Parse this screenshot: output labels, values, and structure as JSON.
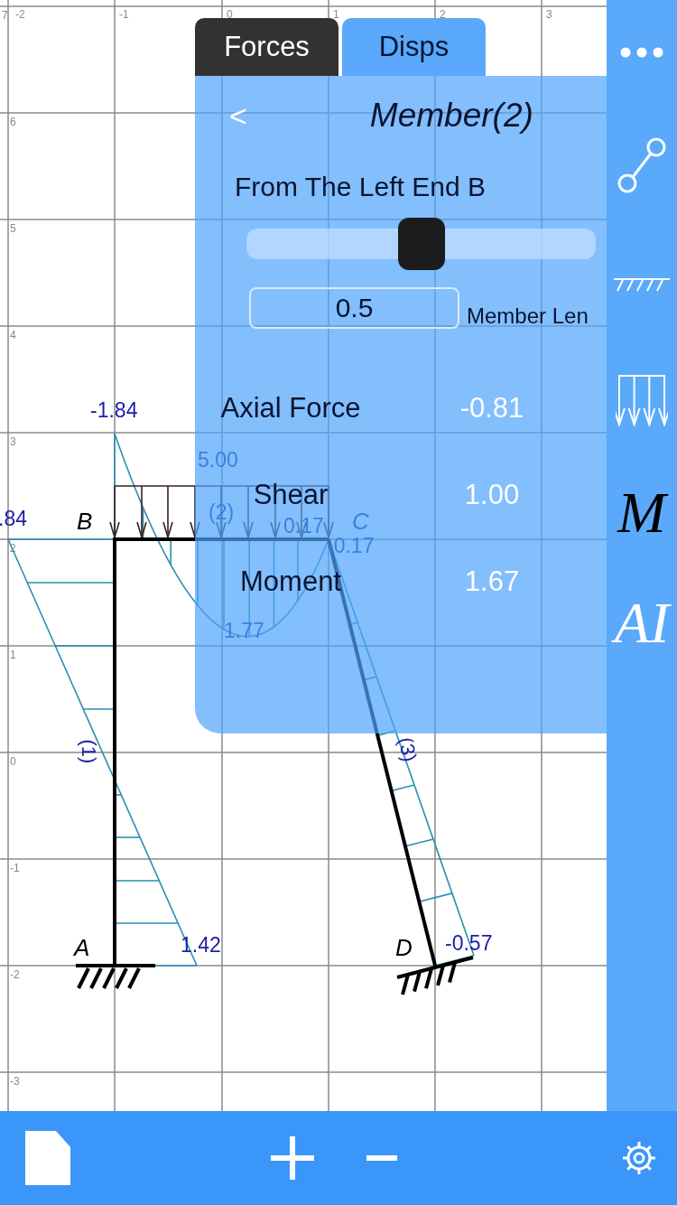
{
  "tabs": [
    {
      "label": "Forces",
      "selected": false
    },
    {
      "label": "Disps",
      "selected": true
    }
  ],
  "panel": {
    "back": "<",
    "title": "Member(2)",
    "position_label": "From The Left End B",
    "slider": {
      "level": 0.5
    },
    "position_field": {
      "value": "0.5"
    },
    "unit_label": "Member Len",
    "results": [
      {
        "label": "Axial Force",
        "value": "-0.81"
      },
      {
        "label": "Shear",
        "value": "1.00"
      },
      {
        "label": "Moment",
        "value": "1.67"
      }
    ]
  },
  "sidebar": {
    "items": [
      {
        "kind": "more"
      },
      {
        "kind": "member"
      },
      {
        "kind": "support"
      },
      {
        "kind": "load"
      },
      {
        "kind": "letter-dark",
        "text": "M"
      },
      {
        "kind": "letter-light",
        "text": "AI"
      }
    ]
  },
  "canvas": {
    "x_ticks": [
      "-2",
      "-1",
      "0",
      "1",
      "2",
      "3"
    ],
    "y_ticks": [
      "7",
      "6",
      "5",
      "4",
      "3",
      "2",
      "1",
      "0",
      "-1",
      "-2",
      "-3"
    ],
    "labels": [
      {
        "kind": "value",
        "text": "-1.84"
      },
      {
        "kind": "value",
        "text": ".84"
      },
      {
        "kind": "value",
        "text": "1.42"
      },
      {
        "kind": "value",
        "text": "-0.57"
      },
      {
        "kind": "faint",
        "text": "5.00"
      },
      {
        "kind": "faint",
        "text": "(2)"
      },
      {
        "kind": "faint",
        "text": "0.17"
      },
      {
        "kind": "faint",
        "text": "-0.17"
      },
      {
        "kind": "faint",
        "text": "1.77"
      },
      {
        "kind": "node",
        "text": "B"
      },
      {
        "kind": "node",
        "text": "A"
      },
      {
        "kind": "node",
        "text": "D"
      },
      {
        "kind": "faint-node",
        "text": "C"
      },
      {
        "kind": "member",
        "text": "(1)"
      },
      {
        "kind": "member",
        "text": "(3)"
      }
    ]
  },
  "toolbar": {
    "items": [
      {
        "kind": "new"
      },
      {
        "kind": "add"
      },
      {
        "kind": "remove"
      },
      {
        "kind": "settings"
      }
    ]
  }
}
